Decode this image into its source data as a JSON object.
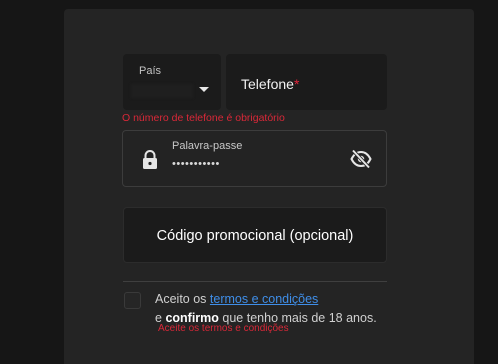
{
  "form": {
    "country": {
      "label": "País"
    },
    "phone": {
      "label": "Telefone",
      "required_mark": "*",
      "error": "O número de telefone é obrigatório"
    },
    "password": {
      "label": "Palavra-passe",
      "value": "•••••••••••",
      "left_icon": "lock-icon",
      "toggle_icon": "eye-off-icon"
    },
    "promo": {
      "label": "Código promocional (opcional)"
    },
    "terms": {
      "prefix": "Aceito os",
      "link": "termos e condições",
      "line2_prefix": "e",
      "line2_bold": "confirmo",
      "line2_suffix": "que tenho mais de 18 anos.",
      "error": "Aceite os termos e condições"
    }
  },
  "colors": {
    "background": "#161616",
    "panel": "#242424",
    "error": "#d92838",
    "link": "#3f8ee8"
  }
}
